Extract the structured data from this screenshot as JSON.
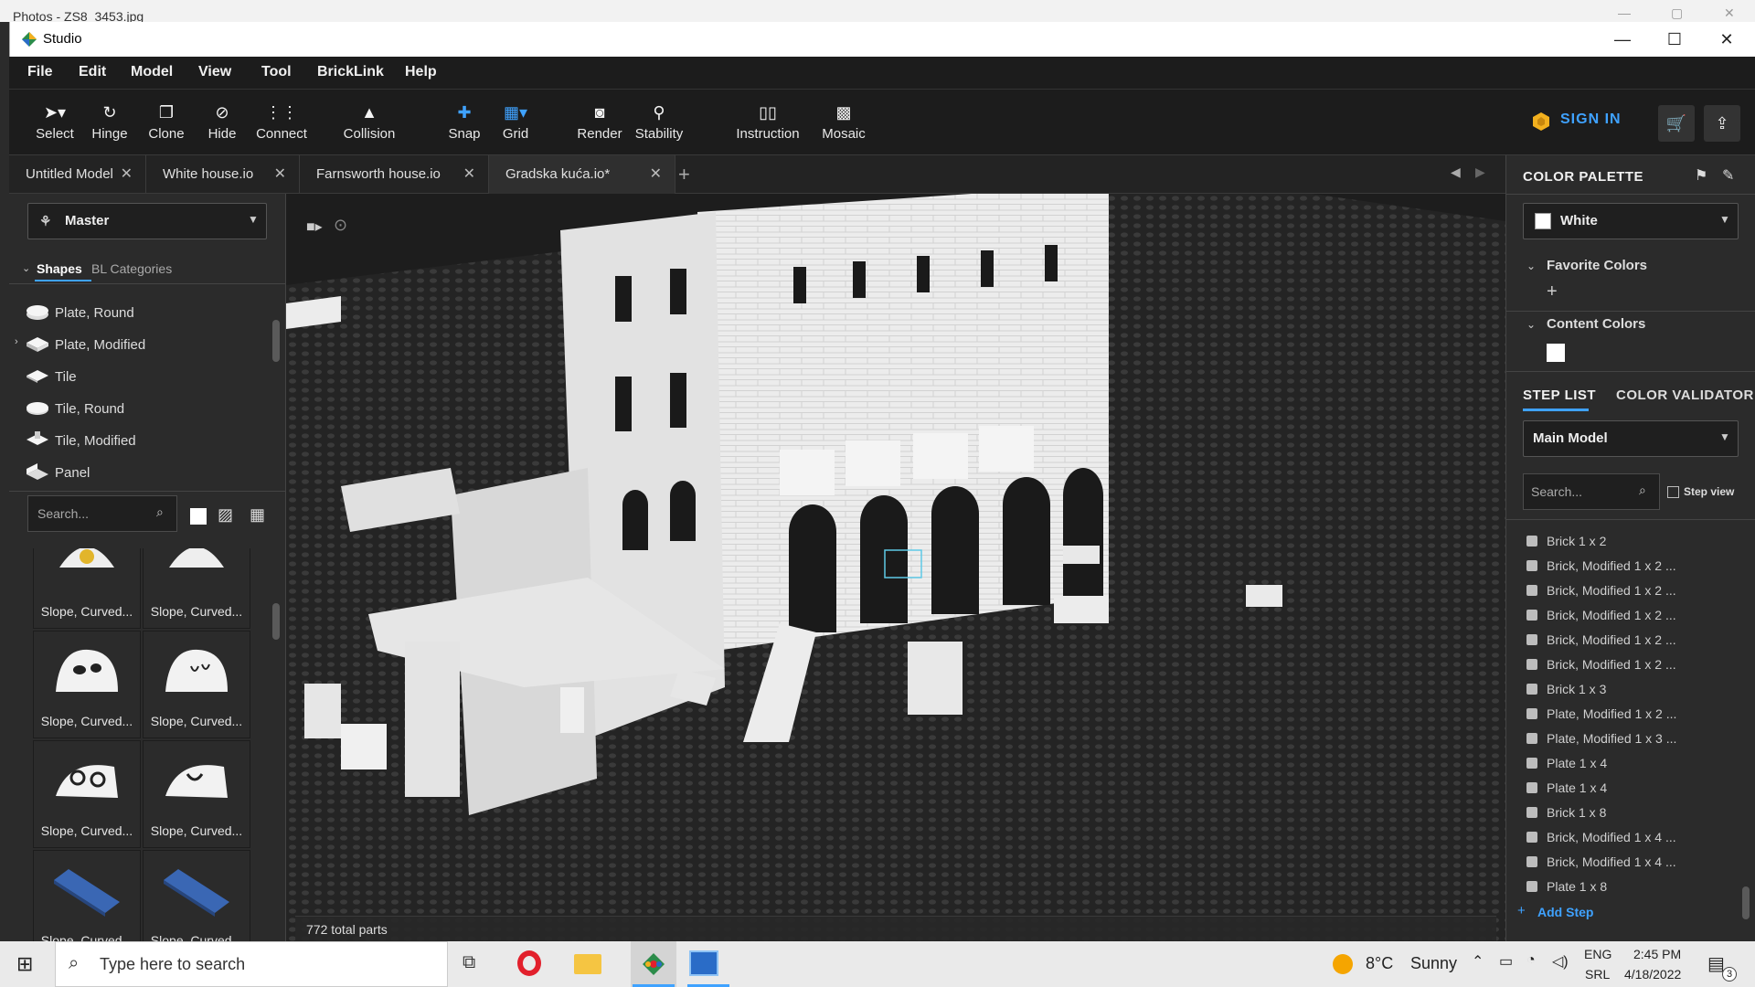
{
  "photos_window": {
    "title": "Photos - ZS8_3453.jpg"
  },
  "app": {
    "title": "Studio"
  },
  "menu": [
    "File",
    "Edit",
    "Model",
    "View",
    "Tool",
    "BrickLink",
    "Help"
  ],
  "tools": [
    {
      "label": "Select",
      "icon": "cursor-icon"
    },
    {
      "label": "Hinge",
      "icon": "hinge-icon"
    },
    {
      "label": "Clone",
      "icon": "clone-icon"
    },
    {
      "label": "Hide",
      "icon": "hide-icon"
    },
    {
      "label": "Connect",
      "icon": "connect-icon"
    },
    {
      "label": "Collision",
      "icon": "collision-icon"
    },
    {
      "label": "Snap",
      "icon": "snap-icon"
    },
    {
      "label": "Grid",
      "icon": "grid-icon"
    },
    {
      "label": "Render",
      "icon": "camera-icon"
    },
    {
      "label": "Stability",
      "icon": "stability-icon"
    },
    {
      "label": "Instruction",
      "icon": "instruction-icon"
    },
    {
      "label": "Mosaic",
      "icon": "mosaic-icon"
    }
  ],
  "signin": "SIGN IN",
  "tabs": [
    "Untitled Model",
    "White house.io",
    "Farnsworth house.io",
    "Gradska kuća.io*"
  ],
  "left": {
    "master": "Master",
    "shapes_tab": "Shapes",
    "bl_tab": "BL Categories",
    "categories": [
      "Plate, Round",
      "Plate, Modified",
      "Tile",
      "Tile, Round",
      "Tile, Modified",
      "Panel"
    ],
    "search_placeholder": "Search...",
    "part_label": "Slope, Curved..."
  },
  "viewport": {
    "total_parts": "772 total parts"
  },
  "right": {
    "palette_title": "COLOR PALETTE",
    "selected_color": "White",
    "favorite": "Favorite Colors",
    "content": "Content Colors",
    "tab_step": "STEP LIST",
    "tab_validator": "COLOR VALIDATOR",
    "model": "Main Model",
    "search_placeholder": "Search...",
    "step_view": "Step view",
    "steps": [
      "Brick 1 x 2",
      "Brick, Modified 1 x 2 ...",
      "Brick, Modified 1 x 2 ...",
      "Brick, Modified 1 x 2 ...",
      "Brick, Modified 1 x 2 ...",
      "Brick, Modified 1 x 2 ...",
      "Brick 1 x 3",
      "Plate, Modified 1 x 2 ...",
      "Plate, Modified 1 x 3 ...",
      "Plate 1 x 4",
      "Plate 1 x 4",
      "Brick 1 x 8",
      "Brick, Modified 1 x 4 ...",
      "Brick, Modified 1 x 4 ...",
      "Plate 1 x 8"
    ],
    "add_step": "Add Step"
  },
  "taskbar": {
    "search": "Type here to search",
    "temp": "8°C",
    "weather": "Sunny",
    "lang1": "ENG",
    "lang2": "SRL",
    "time": "2:45 PM",
    "date": "4/18/2022",
    "notif": "3"
  },
  "colors": {
    "accent": "#3fa2ff",
    "bg": "#2b2b2b",
    "toolbar": "#1c1c1c"
  }
}
